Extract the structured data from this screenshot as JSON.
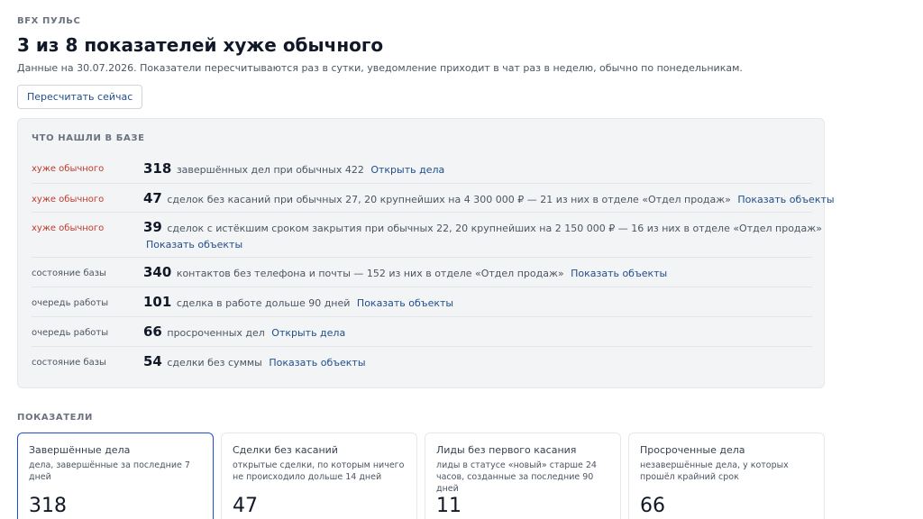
{
  "header": {
    "eyebrow": "BFX ПУЛЬС",
    "title": "3 из 8 показателей хуже обычного",
    "subtitle": "Данные на 30.07.2026. Показатели пересчитываются раз в сутки, уведомление приходит в чат раз в неделю, обычно по понедельникам.",
    "recalc_button": "Пересчитать сейчас"
  },
  "findings": {
    "title": "ЧТО НАШЛИ В БАЗЕ",
    "rows": [
      {
        "tag": "хуже обычного",
        "num": "318",
        "text": "завершённых дел при обычных 422",
        "link": "Открыть дела",
        "link2": ""
      },
      {
        "tag": "хуже обычного",
        "num": "47",
        "text": "сделок без касаний при обычных 27, 20 крупнейших на 4 300 000 ₽ — 21 из них в отделе «Отдел продаж»",
        "link": "Показать объекты",
        "link2": ""
      },
      {
        "tag": "хуже обычного",
        "num": "39",
        "text": "сделок с истёкшим сроком закрытия при обычных 22, 20 крупнейших на 2 150 000 ₽ — 16 из них в отделе «Отдел продаж»",
        "link": "",
        "link2": "Показать объекты"
      },
      {
        "tag": "состояние базы",
        "num": "340",
        "text": "контактов без телефона и почты — 152 из них в отделе «Отдел продаж»",
        "link": "Показать объекты",
        "link2": ""
      },
      {
        "tag": "очередь работы",
        "num": "101",
        "text": "сделка в работе дольше 90 дней",
        "link": "Показать объекты",
        "link2": ""
      },
      {
        "tag": "очередь работы",
        "num": "66",
        "text": "просроченных дел",
        "link": "Открыть дела",
        "link2": ""
      },
      {
        "tag": "состояние базы",
        "num": "54",
        "text": "сделки без суммы",
        "link": "Показать объекты",
        "link2": ""
      }
    ]
  },
  "metrics": {
    "title": "ПОКАЗАТЕЛИ",
    "cards": [
      {
        "title": "Завершённые дела",
        "desc": "дела, завершённые за последние 7 дней",
        "value": "318"
      },
      {
        "title": "Сделки без касаний",
        "desc": "открытые сделки, по которым ничего не происходило дольше 14 дней",
        "value": "47"
      },
      {
        "title": "Лиды без первого касания",
        "desc": "лиды в статусе «новый» старше 24 часов, созданные за последние 90 дней",
        "value": "11"
      },
      {
        "title": "Просроченные дела",
        "desc": "незавершённые дела, у которых прошёл крайний срок",
        "value": "66"
      }
    ]
  },
  "colors": {
    "accent": "#1f4e8c",
    "bad": "#c0392b",
    "active_border": "#1d4ed8"
  }
}
